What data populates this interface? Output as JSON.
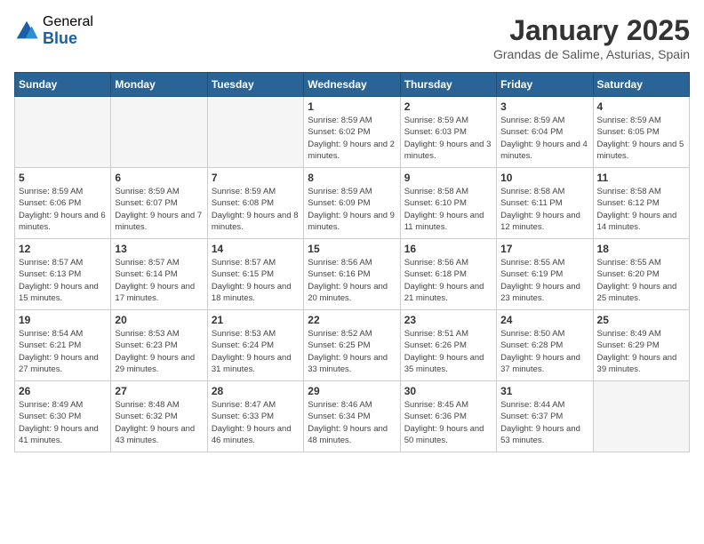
{
  "header": {
    "logo_general": "General",
    "logo_blue": "Blue",
    "month_title": "January 2025",
    "location": "Grandas de Salime, Asturias, Spain"
  },
  "days_of_week": [
    "Sunday",
    "Monday",
    "Tuesday",
    "Wednesday",
    "Thursday",
    "Friday",
    "Saturday"
  ],
  "weeks": [
    [
      {
        "day": "",
        "empty": true
      },
      {
        "day": "",
        "empty": true
      },
      {
        "day": "",
        "empty": true
      },
      {
        "day": "1",
        "sunrise": "8:59 AM",
        "sunset": "6:02 PM",
        "daylight": "9 hours and 2 minutes."
      },
      {
        "day": "2",
        "sunrise": "8:59 AM",
        "sunset": "6:03 PM",
        "daylight": "9 hours and 3 minutes."
      },
      {
        "day": "3",
        "sunrise": "8:59 AM",
        "sunset": "6:04 PM",
        "daylight": "9 hours and 4 minutes."
      },
      {
        "day": "4",
        "sunrise": "8:59 AM",
        "sunset": "6:05 PM",
        "daylight": "9 hours and 5 minutes."
      }
    ],
    [
      {
        "day": "5",
        "sunrise": "8:59 AM",
        "sunset": "6:06 PM",
        "daylight": "9 hours and 6 minutes."
      },
      {
        "day": "6",
        "sunrise": "8:59 AM",
        "sunset": "6:07 PM",
        "daylight": "9 hours and 7 minutes."
      },
      {
        "day": "7",
        "sunrise": "8:59 AM",
        "sunset": "6:08 PM",
        "daylight": "9 hours and 8 minutes."
      },
      {
        "day": "8",
        "sunrise": "8:59 AM",
        "sunset": "6:09 PM",
        "daylight": "9 hours and 9 minutes."
      },
      {
        "day": "9",
        "sunrise": "8:58 AM",
        "sunset": "6:10 PM",
        "daylight": "9 hours and 11 minutes."
      },
      {
        "day": "10",
        "sunrise": "8:58 AM",
        "sunset": "6:11 PM",
        "daylight": "9 hours and 12 minutes."
      },
      {
        "day": "11",
        "sunrise": "8:58 AM",
        "sunset": "6:12 PM",
        "daylight": "9 hours and 14 minutes."
      }
    ],
    [
      {
        "day": "12",
        "sunrise": "8:57 AM",
        "sunset": "6:13 PM",
        "daylight": "9 hours and 15 minutes."
      },
      {
        "day": "13",
        "sunrise": "8:57 AM",
        "sunset": "6:14 PM",
        "daylight": "9 hours and 17 minutes."
      },
      {
        "day": "14",
        "sunrise": "8:57 AM",
        "sunset": "6:15 PM",
        "daylight": "9 hours and 18 minutes."
      },
      {
        "day": "15",
        "sunrise": "8:56 AM",
        "sunset": "6:16 PM",
        "daylight": "9 hours and 20 minutes."
      },
      {
        "day": "16",
        "sunrise": "8:56 AM",
        "sunset": "6:18 PM",
        "daylight": "9 hours and 21 minutes."
      },
      {
        "day": "17",
        "sunrise": "8:55 AM",
        "sunset": "6:19 PM",
        "daylight": "9 hours and 23 minutes."
      },
      {
        "day": "18",
        "sunrise": "8:55 AM",
        "sunset": "6:20 PM",
        "daylight": "9 hours and 25 minutes."
      }
    ],
    [
      {
        "day": "19",
        "sunrise": "8:54 AM",
        "sunset": "6:21 PM",
        "daylight": "9 hours and 27 minutes."
      },
      {
        "day": "20",
        "sunrise": "8:53 AM",
        "sunset": "6:23 PM",
        "daylight": "9 hours and 29 minutes."
      },
      {
        "day": "21",
        "sunrise": "8:53 AM",
        "sunset": "6:24 PM",
        "daylight": "9 hours and 31 minutes."
      },
      {
        "day": "22",
        "sunrise": "8:52 AM",
        "sunset": "6:25 PM",
        "daylight": "9 hours and 33 minutes."
      },
      {
        "day": "23",
        "sunrise": "8:51 AM",
        "sunset": "6:26 PM",
        "daylight": "9 hours and 35 minutes."
      },
      {
        "day": "24",
        "sunrise": "8:50 AM",
        "sunset": "6:28 PM",
        "daylight": "9 hours and 37 minutes."
      },
      {
        "day": "25",
        "sunrise": "8:49 AM",
        "sunset": "6:29 PM",
        "daylight": "9 hours and 39 minutes."
      }
    ],
    [
      {
        "day": "26",
        "sunrise": "8:49 AM",
        "sunset": "6:30 PM",
        "daylight": "9 hours and 41 minutes."
      },
      {
        "day": "27",
        "sunrise": "8:48 AM",
        "sunset": "6:32 PM",
        "daylight": "9 hours and 43 minutes."
      },
      {
        "day": "28",
        "sunrise": "8:47 AM",
        "sunset": "6:33 PM",
        "daylight": "9 hours and 46 minutes."
      },
      {
        "day": "29",
        "sunrise": "8:46 AM",
        "sunset": "6:34 PM",
        "daylight": "9 hours and 48 minutes."
      },
      {
        "day": "30",
        "sunrise": "8:45 AM",
        "sunset": "6:36 PM",
        "daylight": "9 hours and 50 minutes."
      },
      {
        "day": "31",
        "sunrise": "8:44 AM",
        "sunset": "6:37 PM",
        "daylight": "9 hours and 53 minutes."
      },
      {
        "day": "",
        "empty": true
      }
    ]
  ]
}
